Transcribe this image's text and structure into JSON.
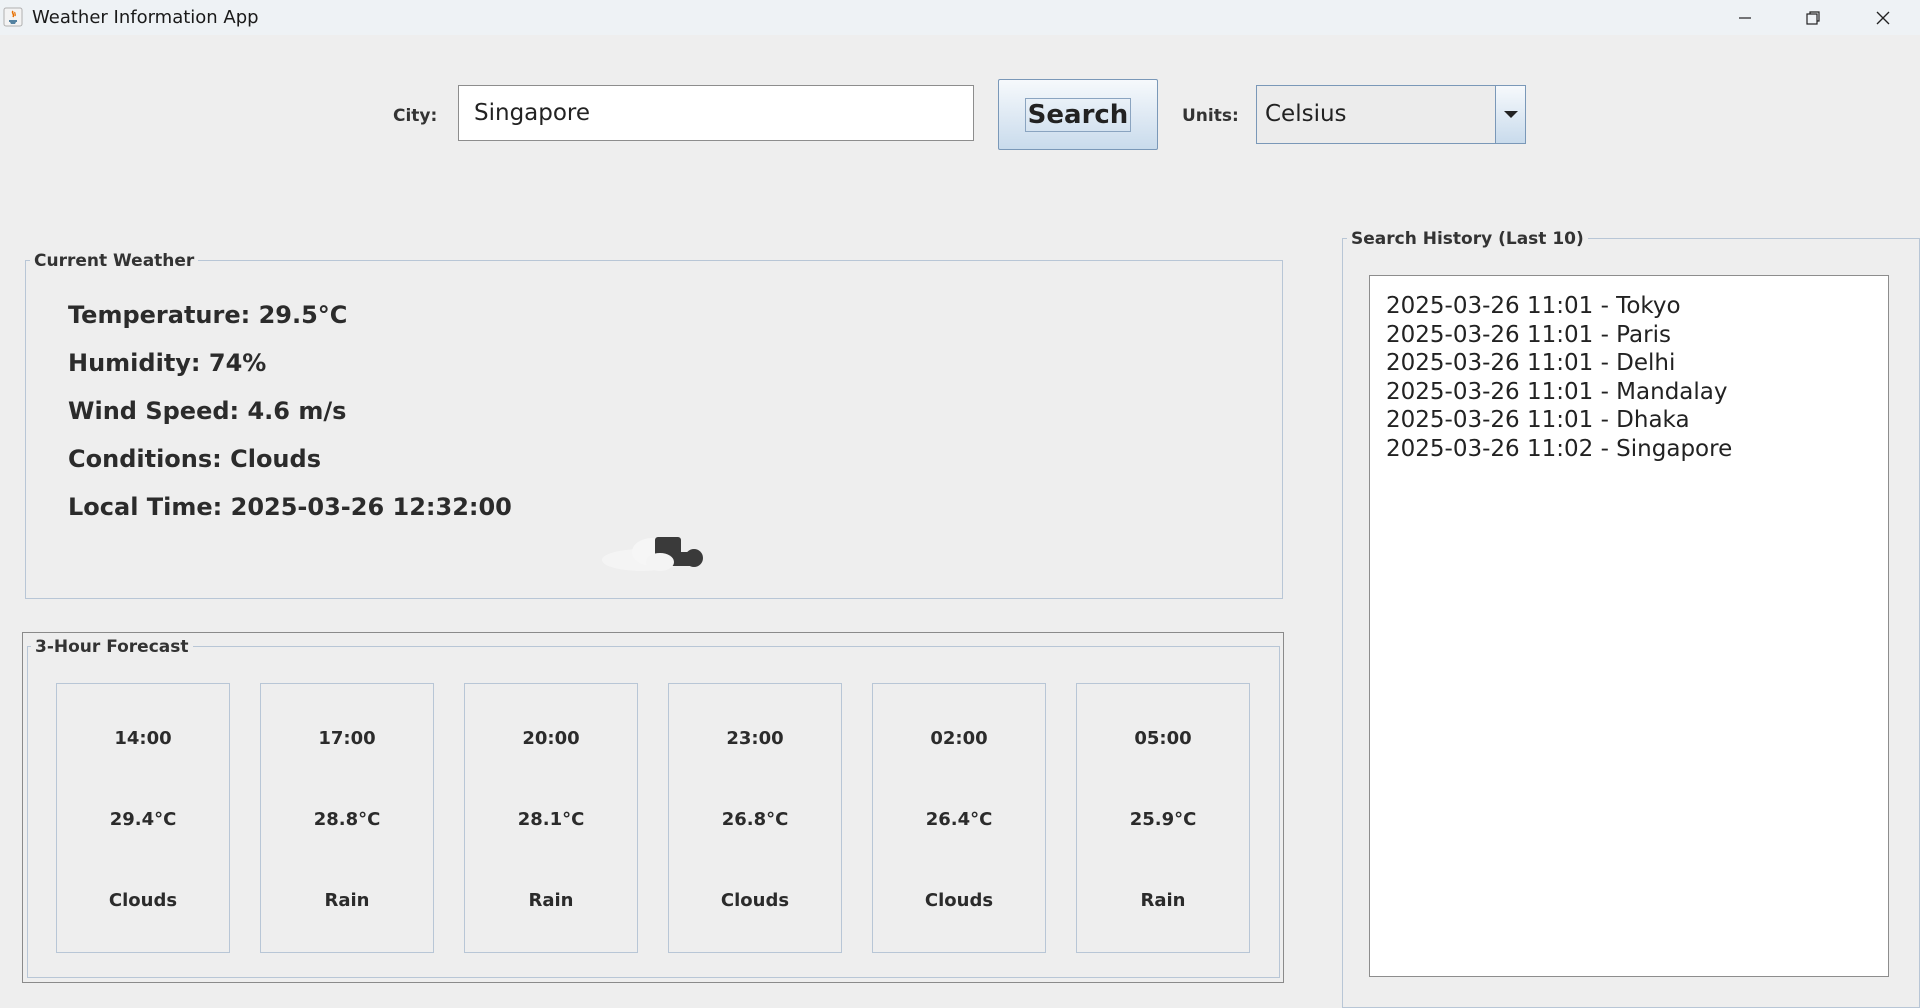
{
  "window": {
    "title": "Weather Information App"
  },
  "search": {
    "city_label": "City:",
    "city_value": "Singapore",
    "search_button": "Search",
    "units_label": "Units:",
    "units_value": "Celsius"
  },
  "current": {
    "panel_title": "Current Weather",
    "temperature": "Temperature: 29.5°C",
    "humidity": "Humidity: 74%",
    "wind": "Wind Speed: 4.6 m/s",
    "conditions": "Conditions: Clouds",
    "local_time": "Local Time: 2025-03-26 12:32:00",
    "icon": "clouds-icon"
  },
  "forecast": {
    "panel_title": "3-Hour Forecast",
    "items": [
      {
        "time": "14:00",
        "temp": "29.4°C",
        "cond": "Clouds"
      },
      {
        "time": "17:00",
        "temp": "28.8°C",
        "cond": "Rain"
      },
      {
        "time": "20:00",
        "temp": "28.1°C",
        "cond": "Rain"
      },
      {
        "time": "23:00",
        "temp": "26.8°C",
        "cond": "Clouds"
      },
      {
        "time": "02:00",
        "temp": "26.4°C",
        "cond": "Clouds"
      },
      {
        "time": "05:00",
        "temp": "25.9°C",
        "cond": "Rain"
      }
    ]
  },
  "history": {
    "panel_title": "Search History (Last 10)",
    "items": [
      "2025-03-26 11:01 - Tokyo",
      "2025-03-26 11:01 - Paris",
      "2025-03-26 11:01 - Delhi",
      "2025-03-26 11:01 - Mandalay",
      "2025-03-26 11:01 - Dhaka",
      "2025-03-26 11:02 - Singapore"
    ]
  }
}
